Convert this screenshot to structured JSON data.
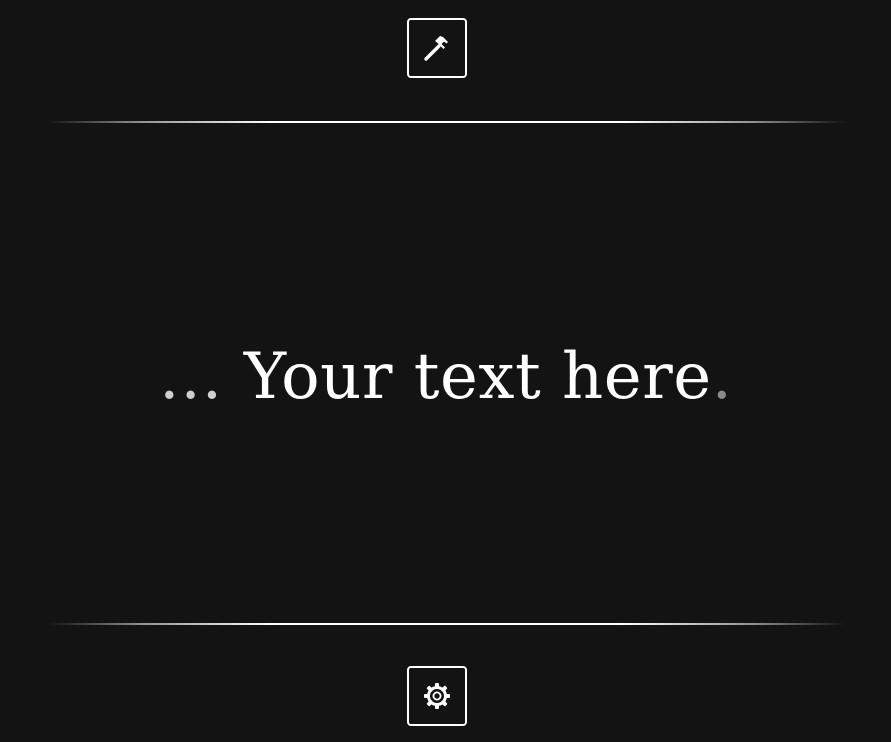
{
  "toolbar_top": {
    "icon": "hammer-icon"
  },
  "headline": {
    "lead": "…",
    "text": "Your text here",
    "tail": "."
  },
  "toolbar_bottom": {
    "icon": "gear-icon"
  },
  "colors": {
    "background": "#131313",
    "foreground": "#ffffff",
    "muted": "#8a8a8a"
  }
}
